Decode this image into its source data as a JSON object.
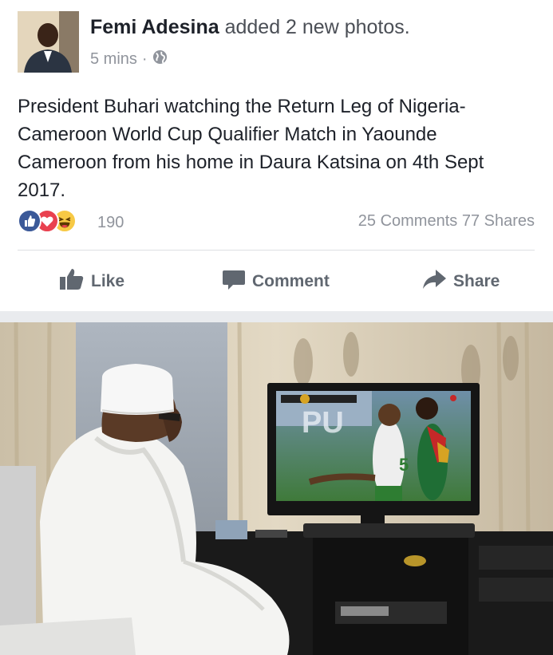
{
  "post": {
    "author_name": "Femi Adesina",
    "action_text": "added 2 new photos.",
    "timestamp": "5 mins",
    "separator": "·",
    "privacy_icon": "globe-icon",
    "body": "President Buhari watching the Return Leg of Nigeria-Cameroon World Cup Qualifier Match in Yaounde Cameroon from his home in Daura Katsina on 4th Sept 2017."
  },
  "stats": {
    "reaction_icons": [
      "like-reaction-icon",
      "love-reaction-icon",
      "haha-reaction-icon"
    ],
    "reaction_count": "190",
    "comments": "25 Comments",
    "shares": "77 Shares"
  },
  "actions": {
    "like_label": "Like",
    "comment_label": "Comment",
    "share_label": "Share"
  },
  "colors": {
    "like_blue": "#3b5998",
    "love_red": "#e9414f",
    "haha_yellow": "#f7c945",
    "secondary_text": "#90949c",
    "action_gray": "#606770"
  }
}
